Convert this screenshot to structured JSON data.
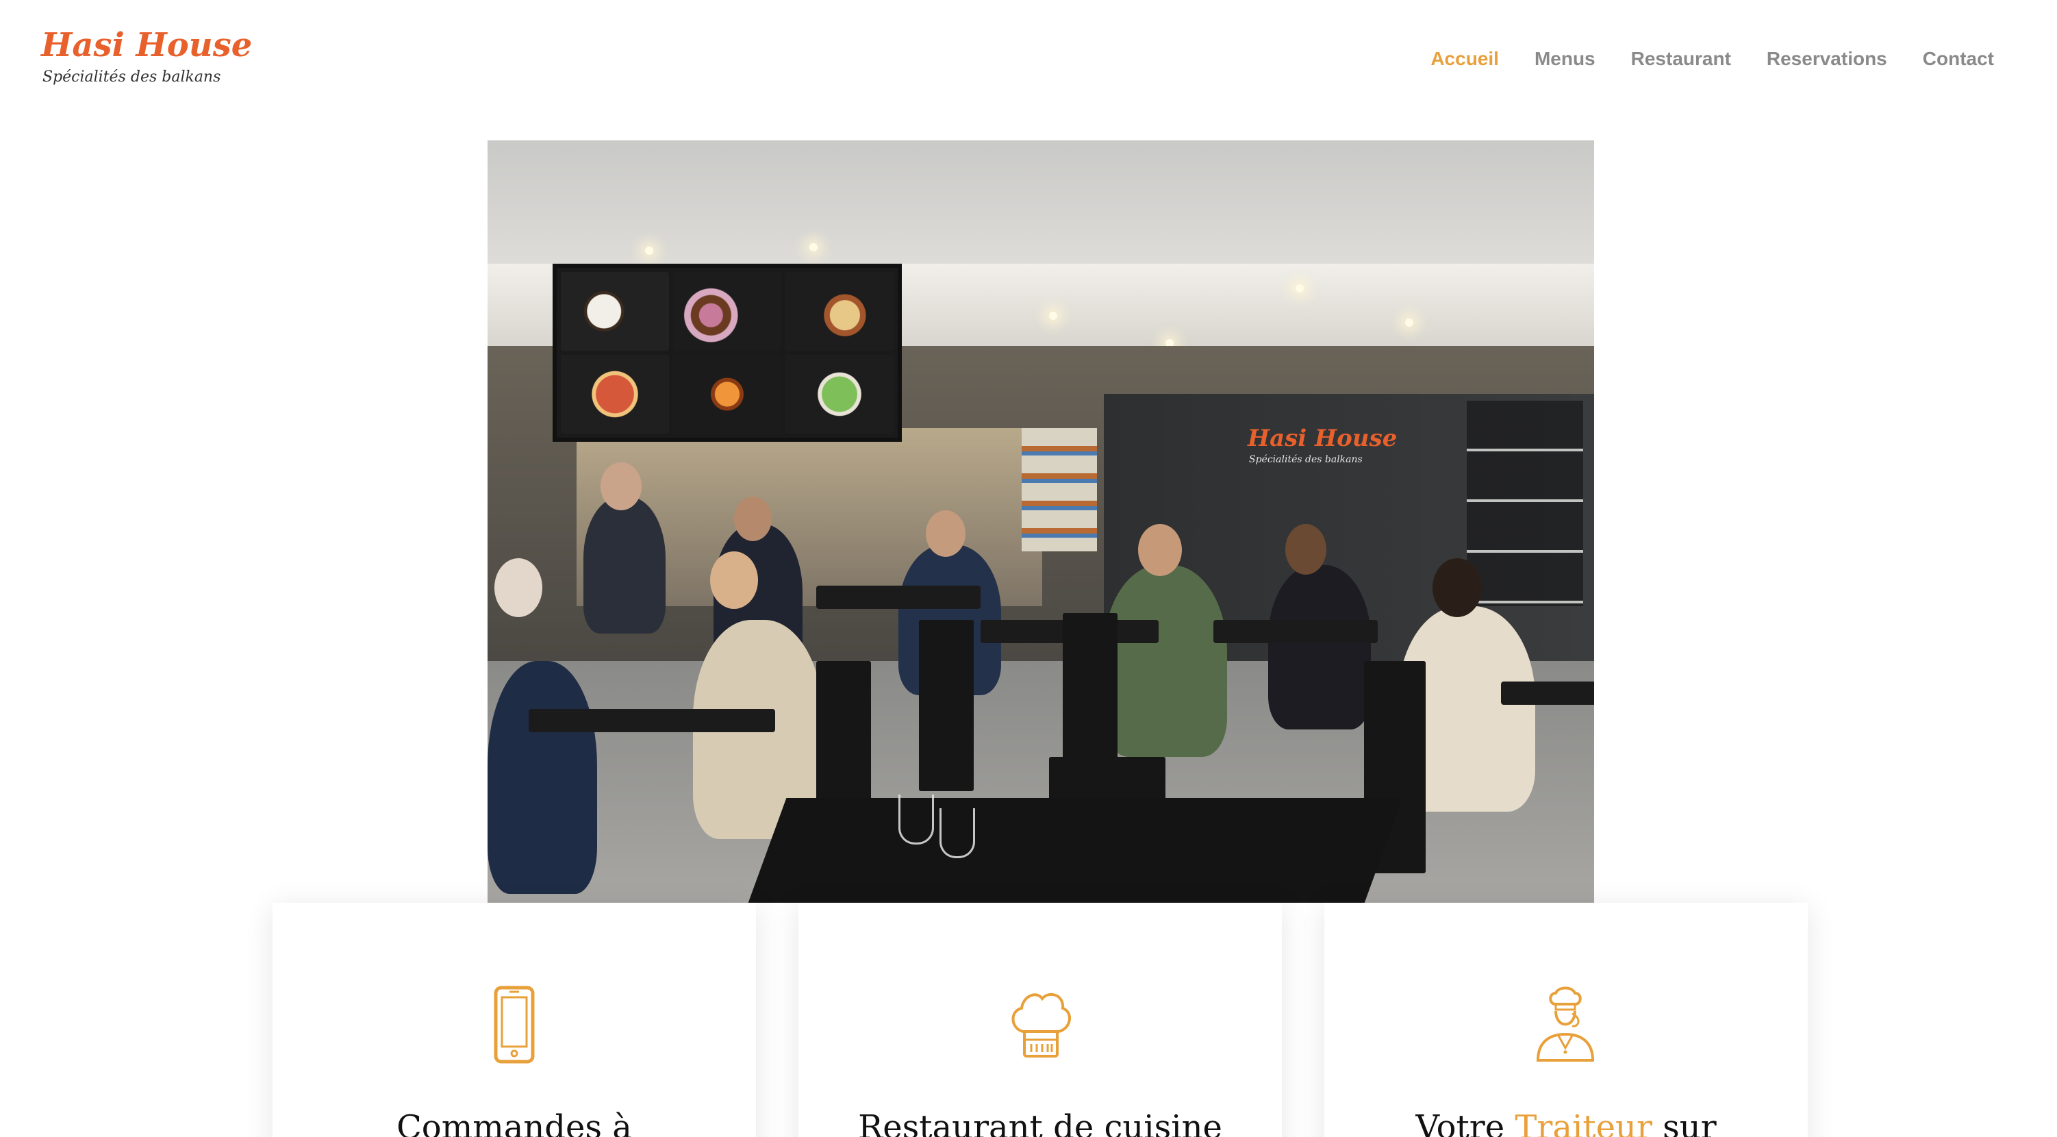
{
  "brand": {
    "name": "Hasi House",
    "tagline": "Spécialités des balkans",
    "accent_color": "#e8602c"
  },
  "nav": {
    "items": [
      {
        "label": "Accueil",
        "active": true
      },
      {
        "label": "Menus",
        "active": false
      },
      {
        "label": "Restaurant",
        "active": false
      },
      {
        "label": "Reservations",
        "active": false
      },
      {
        "label": "Contact",
        "active": false
      }
    ],
    "active_color": "#e8a03a",
    "inactive_color": "#8a8a8a"
  },
  "hero": {
    "wall_sign_name": "Hasi House",
    "wall_sign_tagline": "Spécialités des balkans"
  },
  "cards": [
    {
      "icon": "smartphone-icon",
      "title": "Commandes à",
      "title_accent": "",
      "title_after": ""
    },
    {
      "icon": "chef-hat-icon",
      "title": "Restaurant de cuisine",
      "title_accent": "",
      "title_after": ""
    },
    {
      "icon": "chef-person-icon",
      "title": "Votre ",
      "title_accent": "Traiteur",
      "title_after": " sur"
    }
  ],
  "icon_color": "#e8a03a"
}
